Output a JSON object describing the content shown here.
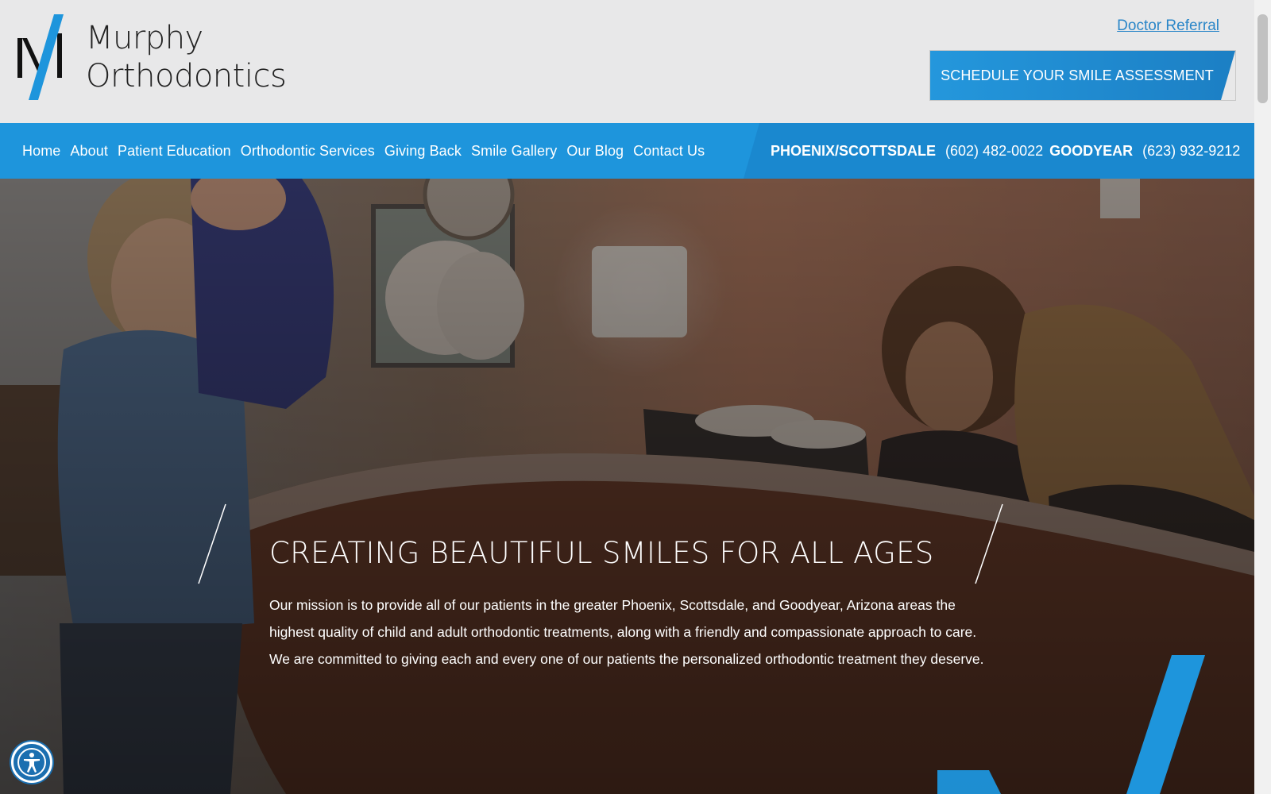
{
  "brand": {
    "name_line1": "Murphy",
    "name_line2": "Orthodontics",
    "logo_icon": "m-logo-icon"
  },
  "header": {
    "doctor_referral": "Doctor Referral",
    "cta_label": "SCHEDULE YOUR SMILE ASSESSMENT"
  },
  "nav": {
    "items": [
      {
        "label": "Home"
      },
      {
        "label": "About"
      },
      {
        "label": "Patient Education"
      },
      {
        "label": "Orthodontic Services"
      },
      {
        "label": "Giving Back"
      },
      {
        "label": "Smile Gallery"
      },
      {
        "label": "Our Blog"
      },
      {
        "label": "Contact Us"
      }
    ],
    "locations": [
      {
        "city": "PHOENIX/SCOTTSDALE",
        "phone": "(602) 482-0022"
      },
      {
        "city": "GOODYEAR",
        "phone": "(623) 932-9212"
      }
    ]
  },
  "hero": {
    "title": "CREATING BEAUTIFUL SMILES FOR ALL AGES",
    "body": "Our mission is to provide all of our patients in the greater Phoenix, Scottsdale, and Goodyear, Arizona areas the highest quality of child and adult orthodontic treatments, along with a friendly and compassionate approach to care. We are committed to giving each and every one of our patients the personalized orthodontic treatment they deserve."
  },
  "accessibility": {
    "icon": "accessibility-icon"
  },
  "colors": {
    "brand_blue": "#1e95dc",
    "cta_blue": "#2a8fd6",
    "header_bg": "#e8e8e9",
    "hero_overlay": "#3a2c26"
  }
}
